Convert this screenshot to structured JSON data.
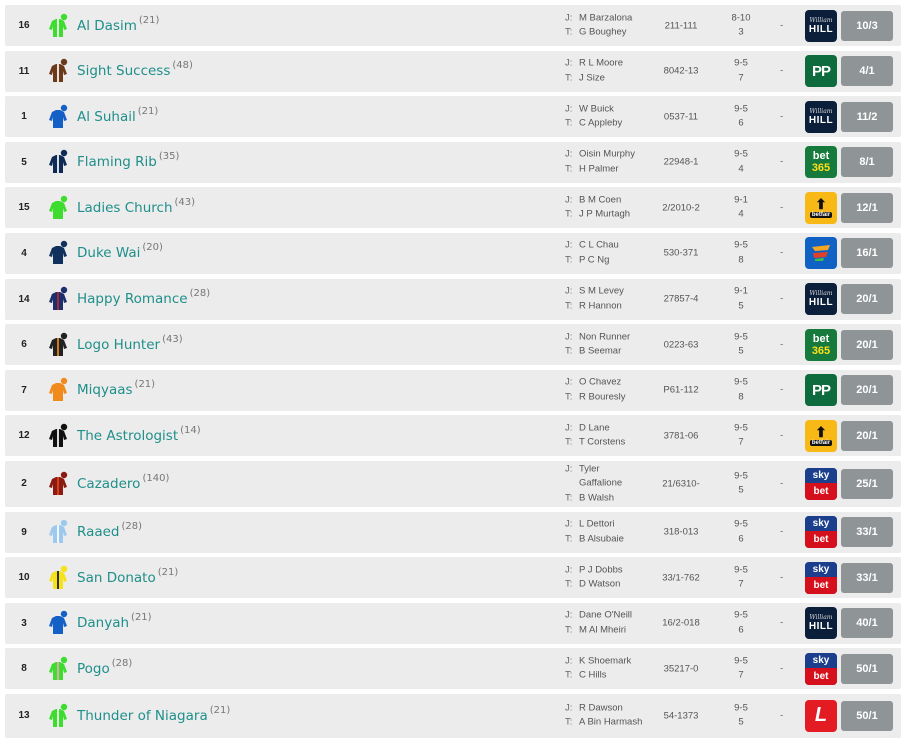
{
  "runners": [
    {
      "num": "16",
      "horse": "Al Dasim",
      "rating": "(21)",
      "jockey": "M Barzalona",
      "trainer": "G Boughey",
      "form": "211-111",
      "wt1": "8-10",
      "wt2": "3",
      "dash": "-",
      "bookie": "williamhill",
      "odds": "10/3",
      "silk": [
        "#3ddc2f",
        "#ffffff"
      ]
    },
    {
      "num": "11",
      "horse": "Sight Success",
      "rating": "(48)",
      "jockey": "R L Moore",
      "trainer": "J Size",
      "form": "8042-13",
      "wt1": "9-5",
      "wt2": "7",
      "dash": "-",
      "bookie": "paddypower",
      "odds": "4/1",
      "silk": [
        "#6b3a1a",
        "#ffffff"
      ]
    },
    {
      "num": "1",
      "horse": "Al Suhail",
      "rating": "(21)",
      "jockey": "W Buick",
      "trainer": "C Appleby",
      "form": "0537-11",
      "wt1": "9-5",
      "wt2": "6",
      "dash": "-",
      "bookie": "williamhill",
      "odds": "11/2",
      "silk": [
        "#1560c7",
        "#1560c7"
      ]
    },
    {
      "num": "5",
      "horse": "Flaming Rib",
      "rating": "(35)",
      "jockey": "Oisin Murphy",
      "trainer": "H Palmer",
      "form": "22948-1",
      "wt1": "9-5",
      "wt2": "4",
      "dash": "-",
      "bookie": "bet365",
      "odds": "8/1",
      "silk": [
        "#0f2a55",
        "#ffffff"
      ]
    },
    {
      "num": "15",
      "horse": "Ladies Church",
      "rating": "(43)",
      "jockey": "B M Coen",
      "trainer": "J P Murtagh",
      "form": "2/2010-2",
      "wt1": "9-1",
      "wt2": "4",
      "dash": "-",
      "bookie": "betfair",
      "odds": "12/1",
      "silk": [
        "#3ddc2f",
        "#3ddc2f"
      ]
    },
    {
      "num": "4",
      "horse": "Duke Wai",
      "rating": "(20)",
      "jockey": "C L Chau",
      "trainer": "P C Ng",
      "form": "530-371",
      "wt1": "9-5",
      "wt2": "8",
      "dash": "-",
      "bookie": "boylesports",
      "odds": "16/1",
      "silk": [
        "#10305e",
        "#10305e"
      ]
    },
    {
      "num": "14",
      "horse": "Happy Romance",
      "rating": "(28)",
      "jockey": "S M Levey",
      "trainer": "R Hannon",
      "form": "27857-4",
      "wt1": "9-1",
      "wt2": "5",
      "dash": "-",
      "bookie": "williamhill",
      "odds": "20/1",
      "silk": [
        "#1d2f6b",
        "#c0262d"
      ]
    },
    {
      "num": "6",
      "horse": "Logo Hunter",
      "rating": "(43)",
      "jockey": "Non Runner",
      "trainer": "B Seemar",
      "form": "0223-63",
      "wt1": "9-5",
      "wt2": "5",
      "dash": "-",
      "bookie": "bet365",
      "odds": "20/1",
      "silk": [
        "#222222",
        "#f08a1c"
      ]
    },
    {
      "num": "7",
      "horse": "Miqyaas",
      "rating": "(21)",
      "jockey": "O Chavez",
      "trainer": "R Bouresly",
      "form": "P61-112",
      "wt1": "9-5",
      "wt2": "8",
      "dash": "-",
      "bookie": "paddypower",
      "odds": "20/1",
      "silk": [
        "#f08a1c",
        "#f08a1c"
      ]
    },
    {
      "num": "12",
      "horse": "The Astrologist",
      "rating": "(14)",
      "jockey": "D Lane",
      "trainer": "T Corstens",
      "form": "3781-06",
      "wt1": "9-5",
      "wt2": "7",
      "dash": "-",
      "bookie": "betfair",
      "odds": "20/1",
      "silk": [
        "#111111",
        "#ffffff"
      ]
    },
    {
      "num": "2",
      "horse": "Cazadero",
      "rating": "(140)",
      "jockey": "Tyler Gaffalione",
      "trainer": "B Walsh",
      "form": "21/6310-",
      "wt1": "9-5",
      "wt2": "5",
      "dash": "-",
      "bookie": "skybet",
      "odds": "25/1",
      "silk": [
        "#8a1a12",
        "#e04b1a"
      ]
    },
    {
      "num": "9",
      "horse": "Raaed",
      "rating": "(28)",
      "jockey": "L Dettori",
      "trainer": "B Alsubaie",
      "form": "318-013",
      "wt1": "9-5",
      "wt2": "6",
      "dash": "-",
      "bookie": "skybet",
      "odds": "33/1",
      "silk": [
        "#9ec9ee",
        "#ffffff"
      ]
    },
    {
      "num": "10",
      "horse": "San Donato",
      "rating": "(21)",
      "jockey": "P J Dobbs",
      "trainer": "D Watson",
      "form": "33/1-762",
      "wt1": "9-5",
      "wt2": "7",
      "dash": "-",
      "bookie": "skybet",
      "odds": "33/1",
      "silk": [
        "#f5e21a",
        "#111111"
      ]
    },
    {
      "num": "3",
      "horse": "Danyah",
      "rating": "(21)",
      "jockey": "Dane O'Neill",
      "trainer": "M Al Mheiri",
      "form": "16/2-018",
      "wt1": "9-5",
      "wt2": "6",
      "dash": "-",
      "bookie": "williamhill",
      "odds": "40/1",
      "silk": [
        "#1560c7",
        "#1560c7"
      ]
    },
    {
      "num": "8",
      "horse": "Pogo",
      "rating": "(28)",
      "jockey": "K Shoemark",
      "trainer": "C Hills",
      "form": "35217-0",
      "wt1": "9-5",
      "wt2": "7",
      "dash": "-",
      "bookie": "skybet",
      "odds": "50/1",
      "silk": [
        "#3ddc2f",
        "#f3a5c0"
      ]
    },
    {
      "num": "13",
      "horse": "Thunder of Niagara",
      "rating": "(21)",
      "jockey": "R Dawson",
      "trainer": "A Bin Harmash",
      "form": "54-1373",
      "wt1": "9-5",
      "wt2": "5",
      "dash": "-",
      "bookie": "ladbrokes",
      "odds": "50/1",
      "silk": [
        "#3ddc2f",
        "#ffffff"
      ]
    }
  ],
  "labels": {
    "jockey": "J:",
    "trainer": "T:"
  },
  "logos": {
    "williamhill": {
      "top": "William",
      "bottom": "HILL"
    },
    "paddypower": {
      "text": "PP"
    },
    "bet365": {
      "top": "bet",
      "bottom": "365"
    },
    "betfair": {
      "top": "⬆",
      "bottom": "betfair"
    },
    "skybet": {
      "top": "sky",
      "bottom": "bet"
    },
    "ladbrokes": {
      "text": "L"
    }
  }
}
